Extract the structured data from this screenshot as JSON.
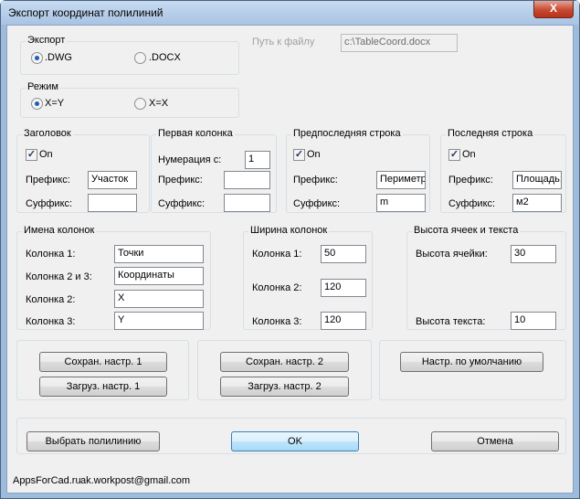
{
  "window": {
    "title": "Экспорт координат полилиний",
    "close_glyph": "X"
  },
  "export": {
    "label": "Экспорт",
    "opt1": ".DWG",
    "opt2": ".DOCX",
    "path_label": "Путь к файлу",
    "path_value": "c:\\TableCoord.docx"
  },
  "mode": {
    "label": "Режим",
    "opt1": "X=Y",
    "opt2": "X=X"
  },
  "header": {
    "label": "Заголовок",
    "on": "On",
    "prefix_label": "Префикс:",
    "prefix_value": "Участок",
    "suffix_label": "Суффикс:",
    "suffix_value": ""
  },
  "first_col": {
    "label": "Первая колонка",
    "numbering_label": "Нумерация с:",
    "numbering_value": "1",
    "prefix_label": "Префикс:",
    "prefix_value": "",
    "suffix_label": "Суффикс:",
    "suffix_value": ""
  },
  "prelast": {
    "label": "Предпоследняя строка",
    "on": "On",
    "prefix_label": "Префикс:",
    "prefix_value": "Периметр",
    "suffix_label": "Суффикс:",
    "suffix_value": "m"
  },
  "last": {
    "label": "Последняя строка",
    "on": "On",
    "prefix_label": "Префикс:",
    "prefix_value": "Площадь:",
    "suffix_label": "Суффикс:",
    "suffix_value": "м2"
  },
  "col_names": {
    "label": "Имена колонок",
    "c1_label": "Колонка 1:",
    "c1_value": "Точки",
    "c23_label": "Колонка 2 и 3:",
    "c23_value": "Координаты",
    "c2_label": "Колонка 2:",
    "c2_value": "X",
    "c3_label": "Колонка 3:",
    "c3_value": "Y"
  },
  "col_width": {
    "label": "Ширина колонок",
    "c1_label": "Колонка 1:",
    "c1_value": "50",
    "c2_label": "Колонка 2:",
    "c2_value": "120",
    "c3_label": "Колонка 3:",
    "c3_value": "120"
  },
  "cell_height": {
    "label": "Высота ячеек и текста",
    "cell_label": "Высота ячейки:",
    "cell_value": "30",
    "text_label": "Высота текста:",
    "text_value": "10"
  },
  "buttons": {
    "save1": "Сохран. настр. 1",
    "load1": "Загруз. настр. 1",
    "save2": "Сохран. настр. 2",
    "load2": "Загруз. настр. 2",
    "defaults": "Настр. по умолчанию",
    "select": "Выбрать полилинию",
    "ok": "OK",
    "cancel": "Отмена"
  },
  "footer": {
    "site": "AppsForCad.ru",
    "email": "ak.workpost@gmail.com"
  }
}
